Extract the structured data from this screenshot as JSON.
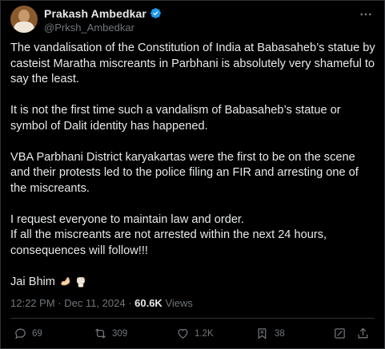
{
  "author": {
    "display_name": "Prakash Ambedkar",
    "handle": "@Prksh_Ambedkar",
    "verified": true,
    "verified_color": "#1d9bf0"
  },
  "tweet": {
    "paragraphs": [
      "The vandalisation of the Constitution of India at Babasaheb’s statue by casteist Maratha miscreants in Parbhani is absolutely very shameful to say the least.",
      "It is not the first time such a vandalism of Babasaheb’s statue or symbol of Dalit identity has happened.",
      "VBA Parbhani District karyakartas were the first to be on the scene and their protests led to the police filing an FIR and arresting one of the miscreants.",
      "I request everyone to maintain law and order.\nIf all the miscreants are not arrested within the next 24 hours, consequences will follow!!!",
      "Jai Bhim"
    ],
    "emojis": [
      "flexed-biceps",
      "raised-fist"
    ]
  },
  "meta": {
    "time_date": "12:22 PM · Dec 11, 2024 · ",
    "views_count": "60.6K",
    "views_label": " Views"
  },
  "actions": {
    "replies": "69",
    "reposts": "309",
    "likes": "1.2K",
    "bookmarks": "38"
  },
  "colors": {
    "background": "#000000",
    "text": "#e7e9ea",
    "muted": "#71767b",
    "border": "#2f3336"
  },
  "icons": [
    "more-icon",
    "verified-badge-icon",
    "reply-icon",
    "repost-icon",
    "like-icon",
    "bookmark-icon",
    "grok-icon",
    "share-icon"
  ]
}
